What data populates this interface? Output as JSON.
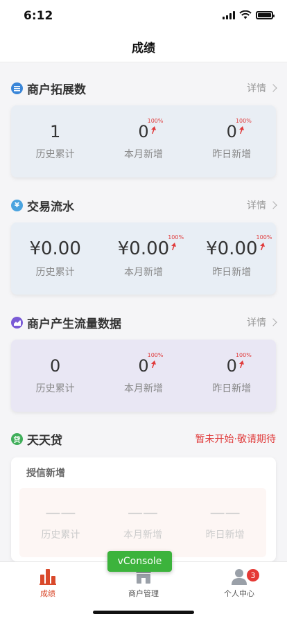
{
  "status_bar": {
    "time": "6:12"
  },
  "nav": {
    "title": "成绩"
  },
  "sections": {
    "merchant": {
      "title": "商户拓展数",
      "more_label": "详情",
      "icon": "list-icon",
      "icon_color": "#3a86d8",
      "card_color": "#e9eef4",
      "stats": [
        {
          "value": "1",
          "label": "历史累计"
        },
        {
          "value": "0",
          "label": "本月新增",
          "change": "100%"
        },
        {
          "value": "0",
          "label": "昨日新增",
          "change": "100%"
        }
      ]
    },
    "transactions": {
      "title": "交易流水",
      "more_label": "详情",
      "icon": "yen-icon",
      "icon_color": "#4aa3df",
      "card_color": "#e8eef5",
      "stats": [
        {
          "value": "¥0.00",
          "label": "历史累计"
        },
        {
          "value": "¥0.00",
          "label": "本月新增",
          "change": "100%"
        },
        {
          "value": "¥0.00",
          "label": "昨日新增",
          "change": "100%"
        }
      ]
    },
    "traffic": {
      "title": "商户产生流量数据",
      "more_label": "详情",
      "icon": "chart-icon",
      "icon_color": "#7a5bd6",
      "card_color": "#e9e7f4",
      "stats": [
        {
          "value": "0",
          "label": "历史累计"
        },
        {
          "value": "0",
          "label": "本月新增",
          "change": "100%"
        },
        {
          "value": "0",
          "label": "昨日新增",
          "change": "100%"
        }
      ]
    },
    "loan": {
      "title": "天天贷",
      "status": "暂未开始·敬请期待",
      "icon": "loan-icon",
      "icon_color": "#3fae5a",
      "sub_title": "授信新增",
      "stats": [
        {
          "value": "——",
          "label": "历史累计"
        },
        {
          "value": "——",
          "label": "本月新增"
        },
        {
          "value": "——",
          "label": "昨日新增"
        }
      ]
    }
  },
  "vconsole": {
    "label": "vConsole"
  },
  "tabbar": {
    "items": [
      {
        "label": "成绩",
        "icon": "bar-chart-icon",
        "active": true
      },
      {
        "label": "商户管理",
        "icon": "store-icon",
        "active": false
      },
      {
        "label": "个人中心",
        "icon": "user-icon",
        "active": false,
        "badge": "3"
      }
    ]
  },
  "colors": {
    "accent": "#d9492b",
    "up_arrow": "#e03b3b"
  }
}
